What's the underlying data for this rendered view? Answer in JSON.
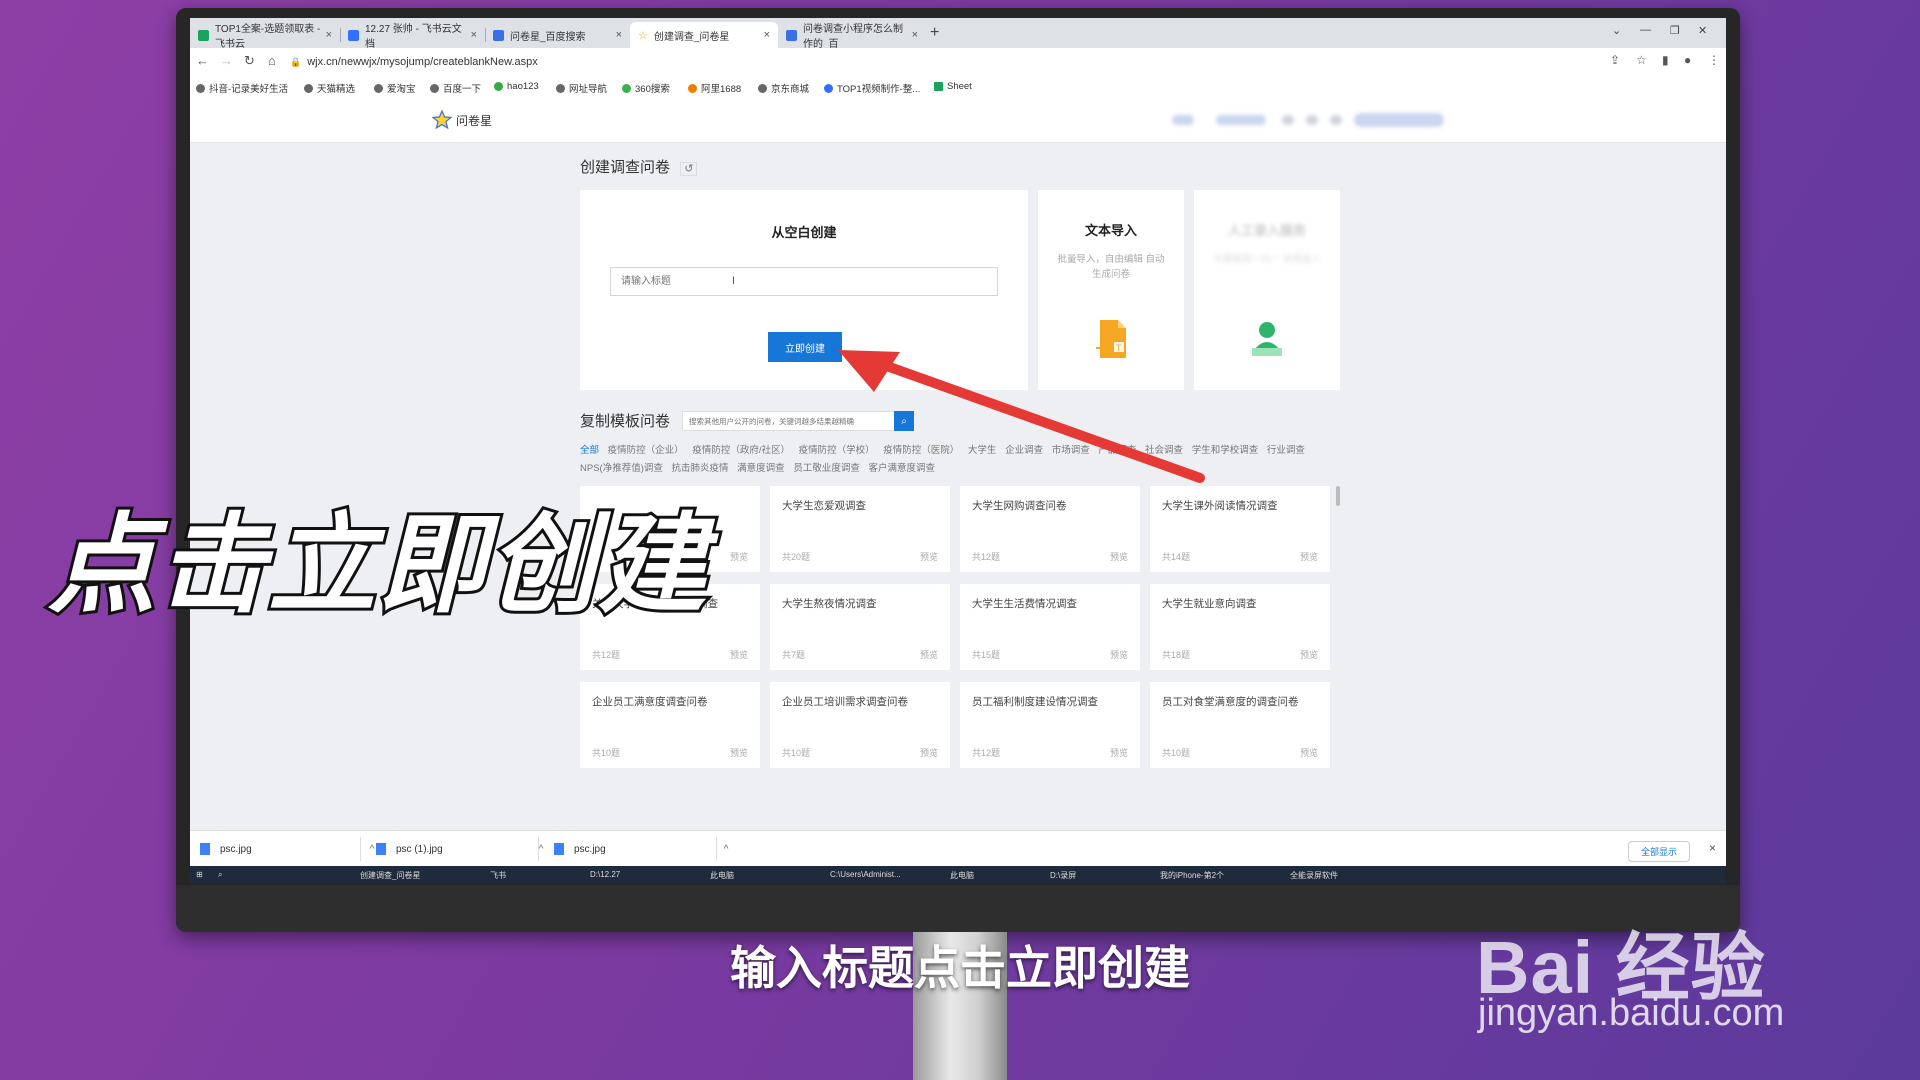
{
  "browser": {
    "tabs": [
      {
        "label": "TOP1全案-选题领取表 - 飞书云",
        "color": "#1aa260"
      },
      {
        "label": "12.27 张帅 - 飞书云文档",
        "color": "#3370ff"
      },
      {
        "label": "问卷星_百度搜索",
        "color": "#3a6fe6"
      },
      {
        "label": "创建调查_问卷星",
        "color": "#f0a500"
      },
      {
        "label": "问卷调查小程序怎么制作的_百",
        "color": "#3a6fe6"
      }
    ],
    "url": "wjx.cn/newwjx/mysojump/createblankNew.aspx",
    "bookmarks": [
      "抖音-记录美好生活",
      "天猫精选",
      "爱淘宝",
      "百度一下",
      "hao123",
      "网址导航",
      "360搜索",
      "阿里1688",
      "京东商城",
      "TOP1视频制作-整...",
      "Sheet"
    ]
  },
  "site": {
    "logo_text": "问卷星"
  },
  "create": {
    "heading": "创建调查问卷",
    "blank_title": "从空白创建",
    "input_placeholder": "请输入标题",
    "create_button": "立即创建",
    "text_import_title": "文本导入",
    "text_import_desc": "批量导入，自由编辑 自动生成问卷",
    "manual_title": "人工录入服务",
    "manual_desc": "专属客服一对一 快速录入"
  },
  "templates": {
    "heading": "复制模板问卷",
    "search_placeholder": "搜索其他用户公开的问卷，关键词越多结果越精确",
    "categories": [
      "全部",
      "疫情防控（企业）",
      "疫情防控（政府/社区）",
      "疫情防控（学校）",
      "疫情防控（医院）",
      "大学生",
      "企业调查",
      "市场调查",
      "产品调查",
      "社会调查",
      "学生和学校调查",
      "行业调查",
      "NPS(净推荐值)调查",
      "抗击肺炎疫情",
      "满意度调查",
      "员工敬业度调查",
      "客户满意度调查"
    ],
    "items": [
      {
        "name": "",
        "count": "",
        "preview": "预览"
      },
      {
        "name": "大学生恋爱观调查",
        "count": "共20题",
        "preview": "预览"
      },
      {
        "name": "大学生网购调查问卷",
        "count": "共12题",
        "preview": "预览"
      },
      {
        "name": "大学生课外阅读情况调查",
        "count": "共14题",
        "preview": "预览"
      },
      {
        "name": "关于大学生兼职情况的调查",
        "count": "共12题",
        "preview": "预览"
      },
      {
        "name": "大学生熬夜情况调查",
        "count": "共7题",
        "preview": "预览"
      },
      {
        "name": "大学生生活费情况调查",
        "count": "共15题",
        "preview": "预览"
      },
      {
        "name": "大学生就业意向调查",
        "count": "共18题",
        "preview": "预览"
      },
      {
        "name": "企业员工满意度调查问卷",
        "count": "共10题",
        "preview": "预览"
      },
      {
        "name": "企业员工培训需求调查问卷",
        "count": "共10题",
        "preview": "预览"
      },
      {
        "name": "员工福利制度建设情况调查",
        "count": "共12题",
        "preview": "预览"
      },
      {
        "name": "员工对食堂满意度的调查问卷",
        "count": "共10题",
        "preview": "预览"
      }
    ]
  },
  "downloads": {
    "items": [
      "psc.jpg",
      "psc (1).jpg",
      "psc.jpg"
    ],
    "show_all": "全部显示"
  },
  "taskbar": {
    "items": [
      "创建调查_问卷星",
      "飞书",
      "D:\\12.27",
      "此电脑",
      "C:\\Users\\Administ...",
      "此电脑",
      "D:\\录屏",
      "我的iPhone-第2个",
      "全能录屏软件"
    ]
  },
  "overlay": {
    "big_caption": "点击立即创建",
    "subtitle": "输入标题点击立即创建"
  },
  "watermark": {
    "brand": "Bai 经验",
    "url": "jingyan.baidu.com"
  },
  "colors": {
    "accent": "#1677d9",
    "arrow": "#e53935",
    "background": "#7b3aa0"
  }
}
